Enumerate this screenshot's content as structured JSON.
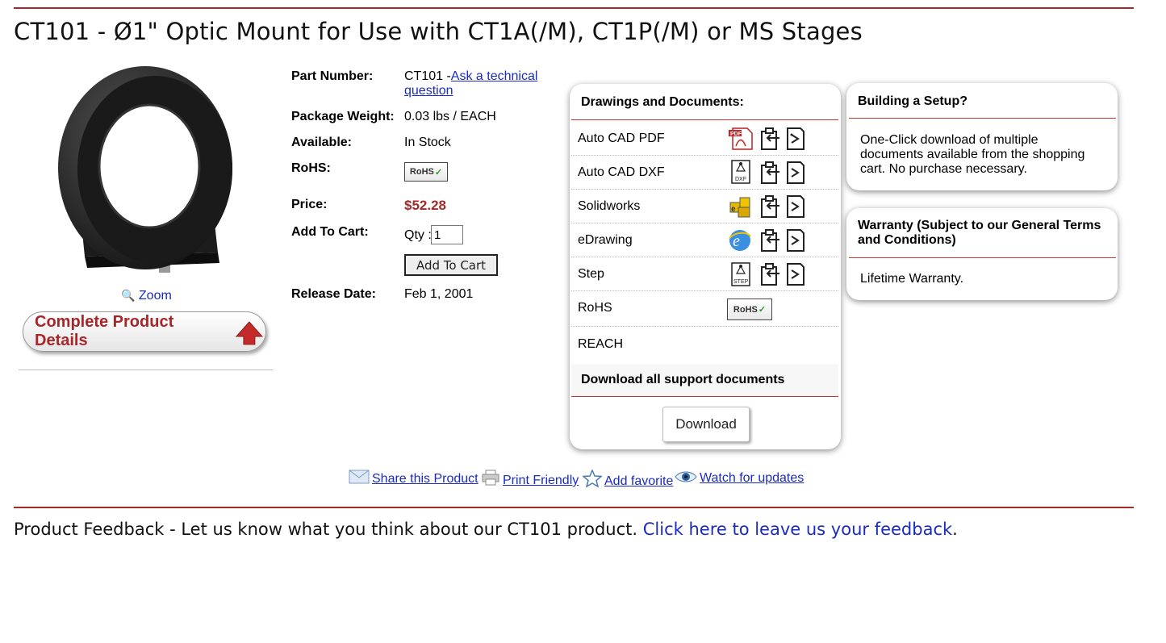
{
  "page": {
    "title": "CT101 - Ø1\" Optic Mount for Use with CT1A(/M), CT1P(/M) or MS Stages"
  },
  "image": {
    "zoom_label": "Zoom",
    "details_button": "Complete Product Details"
  },
  "specs": {
    "part_number_label": "Part Number:",
    "part_number_prefix": "CT101 -",
    "ask_link_line1": "Ask a technical",
    "ask_link_line2": "question",
    "weight_label": "Package Weight:",
    "weight_value": "0.03 lbs / EACH",
    "available_label": "Available:",
    "available_value": "In Stock",
    "rohs_label": "RoHS:",
    "rohs_badge": "RoHS",
    "price_label": "Price:",
    "price_value": "$52.28",
    "cart_label": "Add To Cart:",
    "qty_label": "Qty :",
    "qty_value": "1",
    "add_to_cart_button": "Add To Cart",
    "release_label": "Release Date:",
    "release_value": "Feb 1, 2001"
  },
  "documents": {
    "heading": "Drawings and Documents:",
    "rows": [
      {
        "name": "Auto CAD PDF",
        "icon": "pdf-icon",
        "icon_label": "PDF"
      },
      {
        "name": "Auto CAD DXF",
        "icon": "dxf-icon",
        "icon_label": "DXF"
      },
      {
        "name": "Solidworks",
        "icon": "solidworks-icon",
        "icon_label": ""
      },
      {
        "name": "eDrawing",
        "icon": "edrawing-icon",
        "icon_label": "e"
      },
      {
        "name": "Step",
        "icon": "step-icon",
        "icon_label": "STEP"
      },
      {
        "name": "RoHS",
        "icon": "rohs-badge",
        "icon_label": "RoHS"
      },
      {
        "name": "REACH",
        "icon": "",
        "icon_label": ""
      }
    ],
    "download_all_heading": "Download all support documents",
    "download_button": "Download"
  },
  "setup_panel": {
    "heading": "Building a Setup?",
    "body": "One-Click download of multiple documents available from the shopping cart. No purchase necessary."
  },
  "warranty_panel": {
    "heading": "Warranty (Subject to our General Terms and Conditions)",
    "body": "Lifetime Warranty."
  },
  "actions": {
    "share": "Share this Product",
    "print": "Print Friendly",
    "favorite": "Add favorite",
    "watch": "Watch for updates"
  },
  "feedback": {
    "text": "Product Feedback - Let us know what you think about our CT101 product. ",
    "link": "Click here to leave us your feedback",
    "end": "."
  },
  "colors": {
    "accent_red": "#a42a2a",
    "link_blue": "#1a2bbf"
  }
}
